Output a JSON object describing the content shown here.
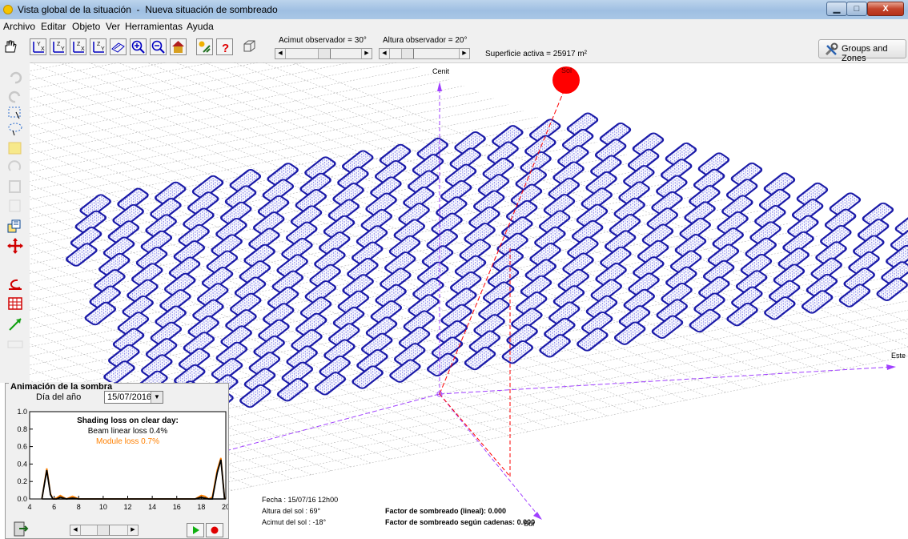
{
  "window": {
    "app_title": "Vista global de la situación",
    "separator": "-",
    "doc_title": "Nueva situación de sombreado",
    "minimize": "▁",
    "maximize": "□",
    "close": "X"
  },
  "menu": [
    "Archivo",
    "Editar",
    "Objeto",
    "Ver",
    "Herramientas",
    "Ayuda"
  ],
  "toolbar": {
    "icons": [
      "hand-pan-icon",
      "axis-xy-icon",
      "axis-xz-icon",
      "axis-yz-icon",
      "perspective-icon",
      "zoom-in-icon",
      "zoom-out-icon",
      "house-icon",
      "sun-tools-icon",
      "help-icon",
      "3d-box-icon"
    ],
    "azimuth_label": "Acimut observador =",
    "azimuth_value": "30°",
    "azimuth_level": 0.5,
    "altitude_label": "Altura observador =",
    "altitude_value": "20°",
    "altitude_level": 0.2,
    "active_surface": "Superficie activa = 25917 m²",
    "groups_button": "Groups and Zones"
  },
  "left_toolbar": [
    "undo-icon",
    "redo-icon",
    "select-rect-icon",
    "lasso-icon",
    "layer-icon",
    "rotate-icon",
    "link-icon",
    "paste-icon",
    "multi-copy-icon",
    "move-icon",
    "rotate-left-icon",
    "table-grid-icon",
    "diagonal-icon",
    "nw-icon"
  ],
  "scene": {
    "cenit_label": "Cenit",
    "sun_label": "Sol",
    "east_label": "Este",
    "south_label": "Sur",
    "sun_color": "#ff0000",
    "panel_color": "#1a1aa8",
    "axis_color": "#a040ff",
    "sunray_color": "#ff0000"
  },
  "info": {
    "fecha": "Fecha :  15/07/16 12h00",
    "altura": "Altura del sol : 69°",
    "acimut": "Acimut del sol : -18°",
    "factor_lineal": "Factor de sombreado (lineal):  0.000",
    "factor_cadenas_prefix": "Factor de sombreado según cadenas:",
    "factor_cadenas_value": "0.000"
  },
  "animation": {
    "title": "Animación de la sombra",
    "day_label": "Día del año",
    "date": "15/07/2016",
    "slider_level": 0.45,
    "play_icon": "play-icon",
    "record_icon": "record-icon"
  },
  "chart_data": {
    "type": "line",
    "title": "Shading loss on clear day:",
    "subtitle_1": "Beam linear loss 0.4%",
    "subtitle_2": "Module loss 0.7%",
    "xlim": [
      4,
      20
    ],
    "ylim": [
      0,
      1.0
    ],
    "x_ticks": [
      "4",
      "6",
      "8",
      "10",
      "12",
      "14",
      "16",
      "18",
      "20"
    ],
    "y_ticks": [
      "0.0",
      "0.2",
      "0.4",
      "0.6",
      "0.8",
      "1.0"
    ],
    "series": [
      {
        "name": "Beam linear loss",
        "color": "#000000",
        "x": [
          5.0,
          5.4,
          5.7,
          5.9,
          6.2,
          6.5,
          7.0,
          7.5,
          8.0,
          17.5,
          18.0,
          18.3,
          18.6,
          18.9,
          19.3,
          19.6,
          19.9
        ],
        "y": [
          0.0,
          0.33,
          0.05,
          0.0,
          0.0,
          0.02,
          0.0,
          0.01,
          0.0,
          0.0,
          0.02,
          0.01,
          0.0,
          0.0,
          0.3,
          0.45,
          0.0
        ]
      },
      {
        "name": "Module loss",
        "color": "#ff8000",
        "x": [
          5.0,
          5.4,
          5.7,
          5.9,
          6.2,
          6.5,
          7.0,
          7.5,
          8.0,
          17.5,
          18.0,
          18.3,
          18.6,
          18.9,
          19.3,
          19.6,
          19.9
        ],
        "y": [
          0.0,
          0.35,
          0.06,
          0.0,
          0.01,
          0.04,
          0.0,
          0.03,
          0.0,
          0.0,
          0.04,
          0.03,
          0.0,
          0.02,
          0.33,
          0.47,
          0.0
        ]
      }
    ]
  }
}
